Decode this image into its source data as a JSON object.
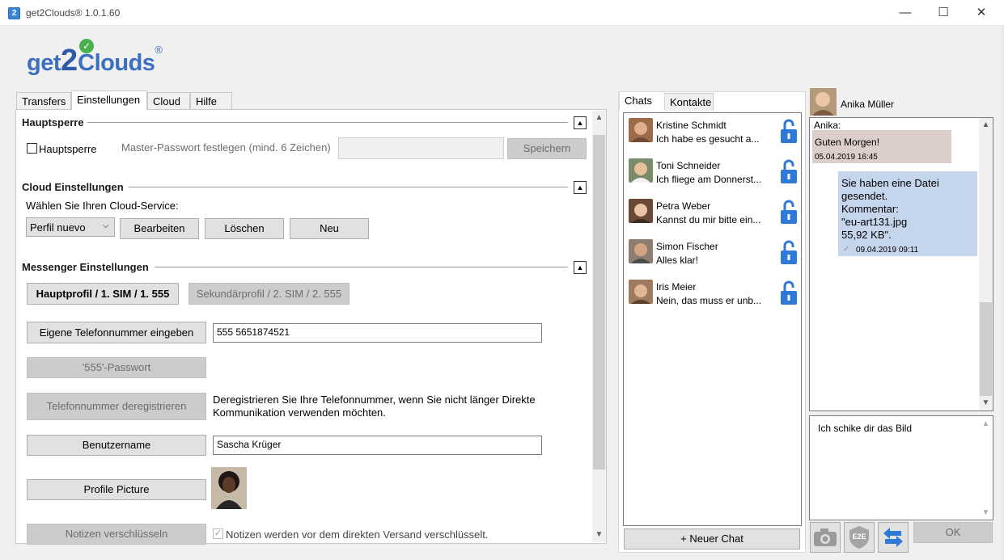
{
  "window": {
    "title": "get2Clouds® 1.0.1.60",
    "icon_glyph": "2",
    "minimize": "—",
    "maximize": "☐",
    "close": "✕"
  },
  "logo": {
    "get": "get",
    "two": "2",
    "clouds": "Clouds",
    "reg": "®"
  },
  "tabs": [
    {
      "label": "Transfers"
    },
    {
      "label": "Einstellungen"
    },
    {
      "label": "Cloud"
    },
    {
      "label": "Hilfe"
    }
  ],
  "hauptsperre": {
    "title": "Hauptsperre",
    "checkbox_label": "Hauptsperre",
    "password_hint": "Master-Passwort festlegen (mind. 6 Zeichen)",
    "password_value": "",
    "save_label": "Speichern",
    "collapse_glyph": "▲"
  },
  "cloud": {
    "title": "Cloud Einstellungen",
    "prompt": "Wählen Sie Ihren Cloud-Service:",
    "selected": "Perfil nuevo",
    "edit_label": "Bearbeiten",
    "delete_label": "Löschen",
    "new_label": "Neu",
    "collapse_glyph": "▲"
  },
  "messenger": {
    "title": "Messenger Einstellungen",
    "collapse_glyph": "▲",
    "main_profile": "Hauptprofil / 1. SIM / 1. 555",
    "secondary_profile": "Sekundärprofil / 2. SIM / 2. 555",
    "phone_button": "Eigene Telefonnummer eingeben",
    "phone_value": "555 5651874521",
    "password_button": "'555'-Passwort",
    "deregister_button": "Telefonnummer deregistrieren",
    "deregister_text": "Deregistrieren Sie Ihre Telefonnummer, wenn Sie nicht länger Direkte Kommunikation verwenden möchten.",
    "username_button": "Benutzername",
    "username_value": "Sascha Krüger",
    "picture_button": "Profile Picture",
    "encrypt_button": "Notizen verschlüsseln",
    "encrypt_text": "Notizen werden vor dem direkten Versand verschlüsselt.",
    "check_glyph": "✓"
  },
  "chat_tabs": [
    {
      "label": "Chats"
    },
    {
      "label": "Kontakte"
    }
  ],
  "chats": [
    {
      "name": "Kristine Schmidt",
      "message": "Ich habe es gesucht a..."
    },
    {
      "name": "Toni Schneider",
      "message": "Ich fliege am Donnerst..."
    },
    {
      "name": "Petra Weber",
      "message": "Kannst du mir bitte ein..."
    },
    {
      "name": "Simon Fischer",
      "message": "Alles klar!"
    },
    {
      "name": "Iris Meier",
      "message": "Nein, das muss er unb..."
    }
  ],
  "new_chat": "+ Neuer Chat",
  "conversation": {
    "contact": "Anika Müller",
    "sender_label": "Anika:",
    "incoming_text": "Guten Morgen!",
    "incoming_time": "05.04.2019 16:45",
    "outgoing_lines": [
      "Sie haben eine Datei",
      "gesendet.",
      "Kommentar:",
      "\"eu-art131.jpg",
      "55,92 KB\"."
    ],
    "outgoing_time": "09.04.2019 09:11",
    "outgoing_check": "✓",
    "draft": "Ich schike dir das Bild",
    "ok_label": "OK",
    "e2e_label": "E2E"
  },
  "scroll": {
    "up": "▲",
    "down": "▼"
  },
  "colors": {
    "accent": "#3d6fc1",
    "lock_blue": "#2f7ad8",
    "bubble_in": "#dccfcb",
    "bubble_out": "#c5d5ec"
  },
  "icons": {
    "lock": "unlock-icon",
    "camera": "camera-icon",
    "e2e": "shield-icon",
    "send": "swap-arrows-icon"
  }
}
